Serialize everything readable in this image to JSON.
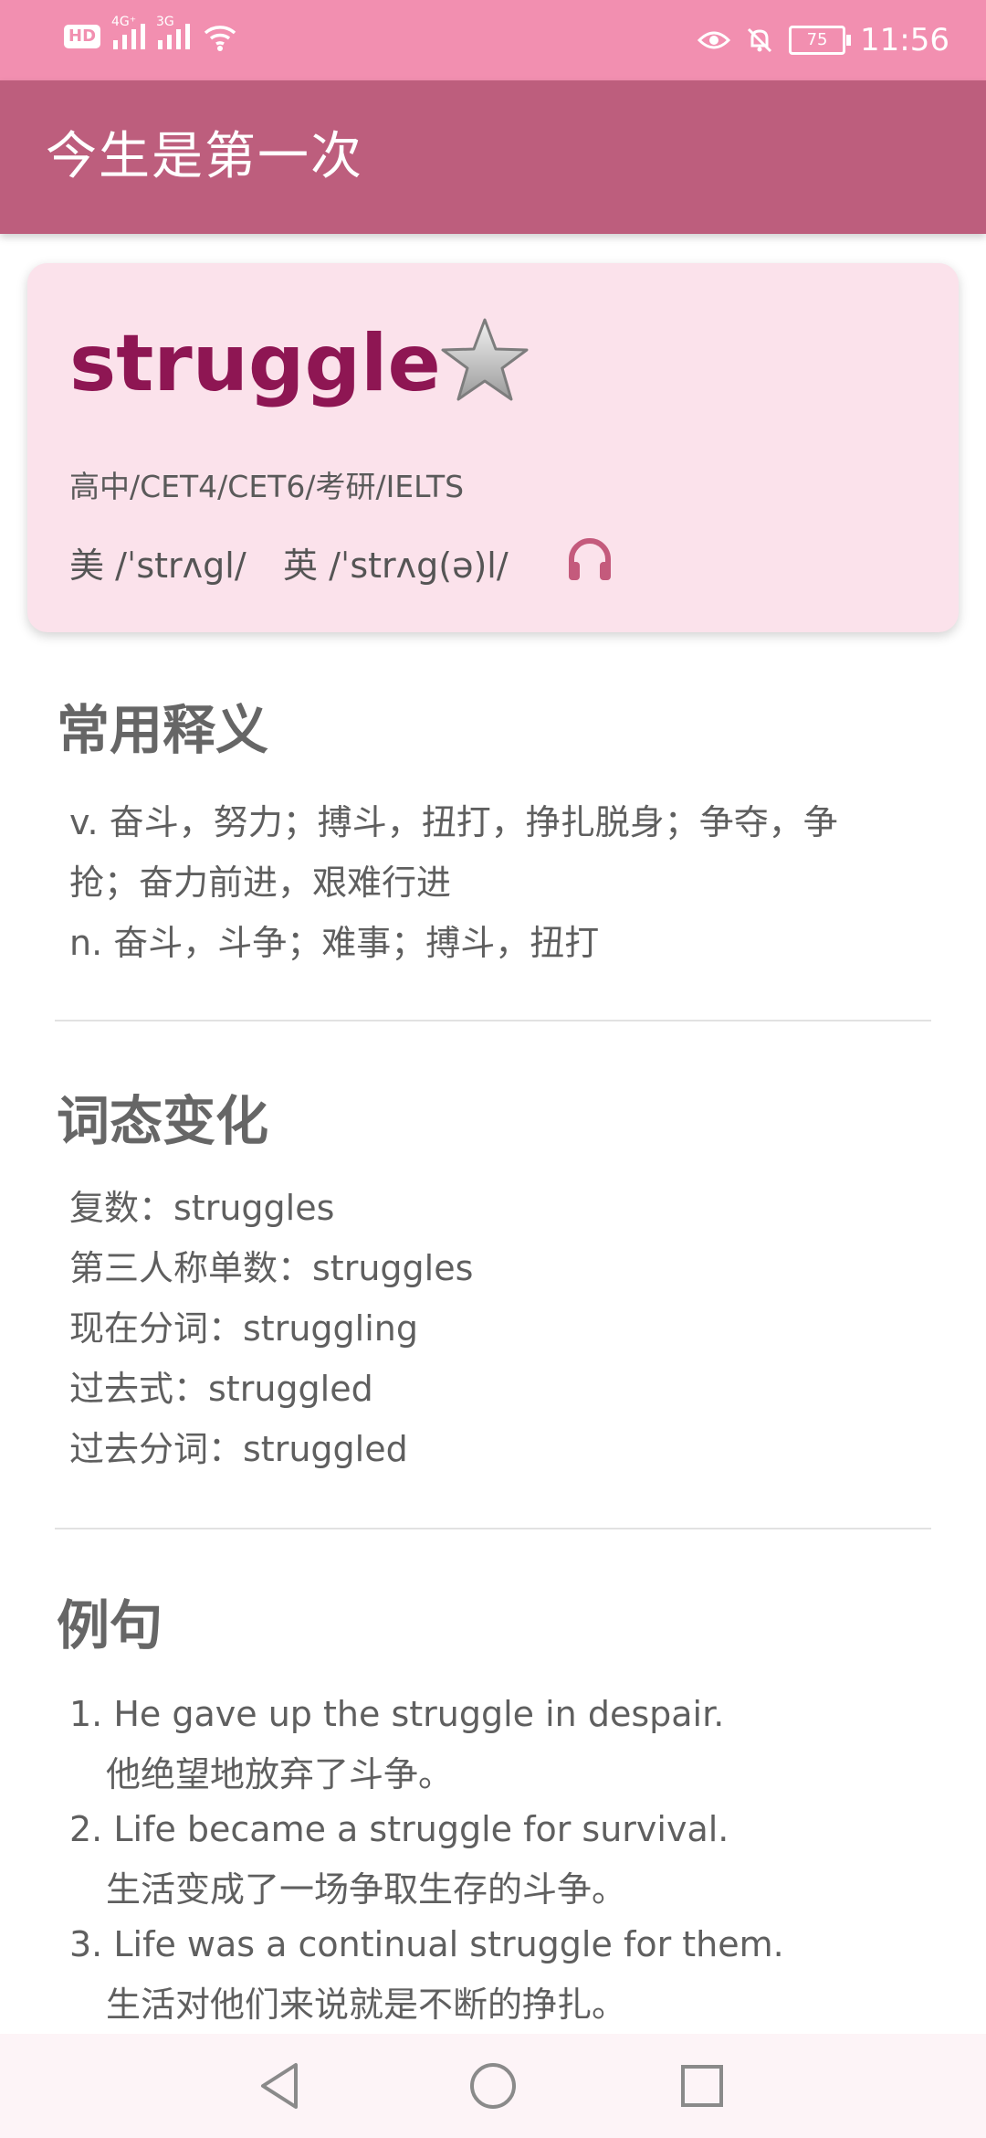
{
  "status_bar": {
    "badge_hd": "HD",
    "network_1": "4G⁺",
    "network_2": "3G",
    "battery": "75",
    "time": "11:56"
  },
  "app_bar": {
    "title": "今生是第一次"
  },
  "word_card": {
    "word": "struggle",
    "levels": "高中/CET4/CET6/考研/IELTS",
    "phonetic_us": "美 /ˈstrʌgl/",
    "phonetic_uk": "英 /ˈstrʌg(ə)l/",
    "accent_color": "#8e1653",
    "card_bg": "#fbe2eb"
  },
  "definitions": {
    "title": "常用释义",
    "lines": [
      "v. 奋斗，努力；搏斗，扭打，挣扎脱身；争夺，争",
      "抢；奋力前进，艰难行进",
      "n. 奋斗，斗争；难事；搏斗，扭打"
    ]
  },
  "inflections": {
    "title": "词态变化",
    "items": [
      "复数：struggles",
      "第三人称单数：struggles",
      "现在分词：struggling",
      "过去式：struggled",
      "过去分词：struggled"
    ]
  },
  "examples": {
    "title": "例句",
    "items": [
      {
        "en": "1. He gave up the struggle in despair.",
        "zh": "他绝望地放弃了斗争。"
      },
      {
        "en": "2. Life became a struggle for survival.",
        "zh": "生活变成了一场争取生存的斗争。"
      },
      {
        "en": "3. Life was a continual struggle for them.",
        "zh": "生活对他们来说就是不断的挣扎。"
      }
    ]
  },
  "icons": {
    "star": "star-icon",
    "audio": "headphones-icon",
    "back": "back-triangle-icon",
    "home": "home-circle-icon",
    "recents": "recents-square-icon"
  },
  "colors": {
    "status_bar": "#f28fb0",
    "app_bar": "#bd5e7d",
    "headphone": "#c45a7c"
  }
}
